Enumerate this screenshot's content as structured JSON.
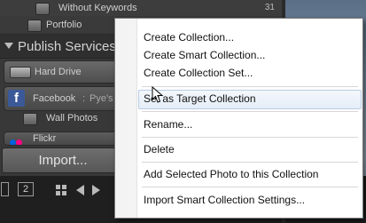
{
  "collections": {
    "without_keywords_label": "Without Keywords",
    "without_keywords_count": "31",
    "portfolio_label": "Portfolio"
  },
  "publish_services": {
    "title": "Publish Services",
    "hard_drive_label": "Hard Drive",
    "facebook_label": "Facebook",
    "facebook_account": "Pye's",
    "facebook_icon": "f",
    "wall_photos_label": "Wall Photos",
    "flickr_label": "Flickr"
  },
  "import_button_label": "Import...",
  "filmstrip": {
    "page_number": "2"
  },
  "context_menu": {
    "items": [
      {
        "label": "Create Collection..."
      },
      {
        "label": "Create Smart Collection..."
      },
      {
        "label": "Create Collection Set..."
      },
      {
        "label": "Set as Target Collection"
      },
      {
        "label": "Rename..."
      },
      {
        "label": "Delete"
      },
      {
        "label": "Add Selected Photo to this Collection"
      },
      {
        "label": "Import Smart Collection Settings..."
      }
    ],
    "highlighted_index": 3
  },
  "colors": {
    "facebook_blue": "#3b5998",
    "menu_highlight_border": "#b9cce3",
    "panel_background": "#383838"
  }
}
